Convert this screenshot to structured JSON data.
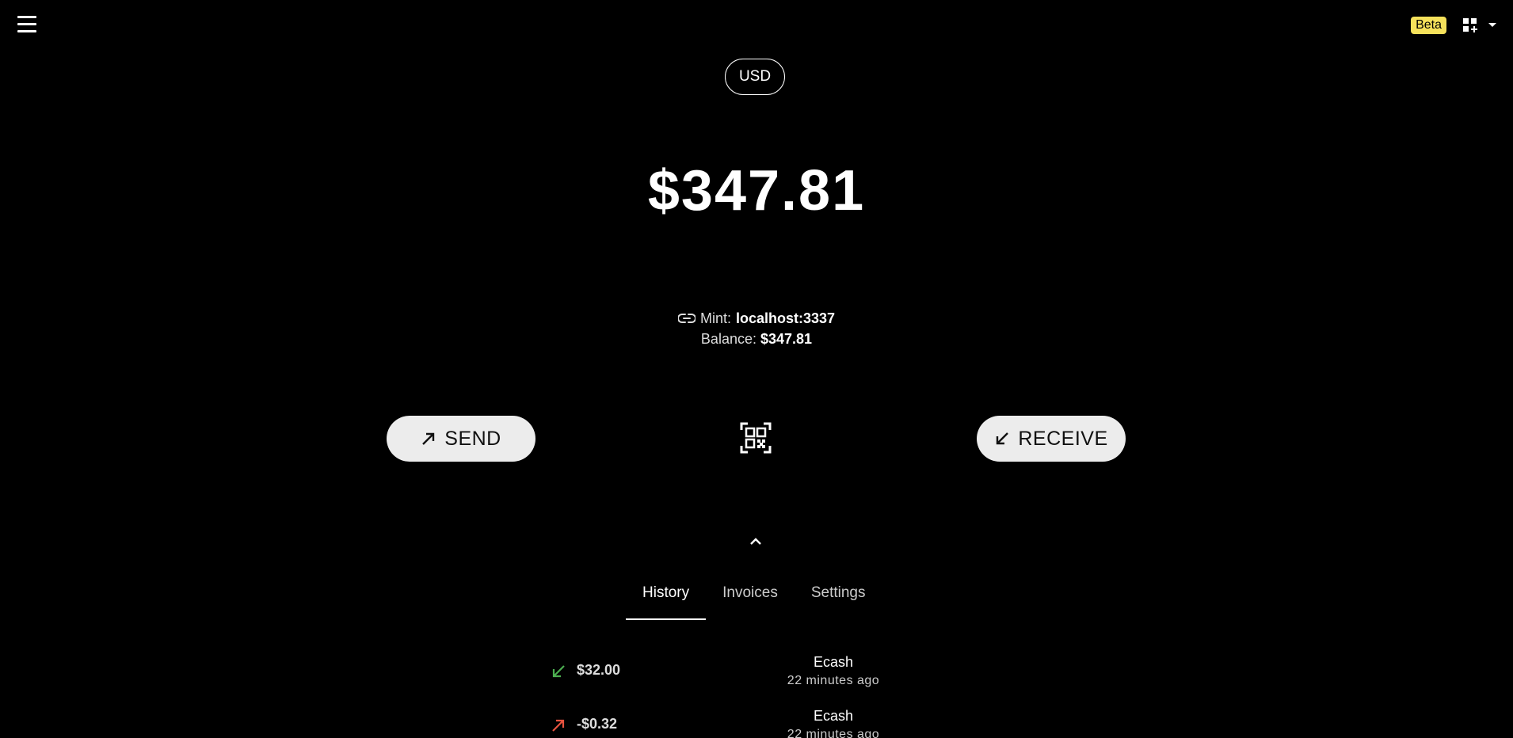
{
  "header": {
    "beta_label": "Beta"
  },
  "currency": {
    "selected": "USD"
  },
  "balance": {
    "total": "$347.81"
  },
  "mint": {
    "label": "Mint:",
    "url": "localhost:3337",
    "balance_label": "Balance:",
    "balance_value": "$347.81"
  },
  "actions": {
    "send_label": "SEND",
    "receive_label": "RECEIVE"
  },
  "tabs": [
    {
      "label": "History",
      "active": true
    },
    {
      "label": "Invoices",
      "active": false
    },
    {
      "label": "Settings",
      "active": false
    }
  ],
  "history": [
    {
      "direction": "incoming",
      "amount": "$32.00",
      "type": "Ecash",
      "time": "22 minutes ago",
      "color": "#4caf50"
    },
    {
      "direction": "outgoing",
      "amount": "-$0.32",
      "type": "Ecash",
      "time": "22 minutes ago",
      "color": "#e8533f"
    }
  ]
}
